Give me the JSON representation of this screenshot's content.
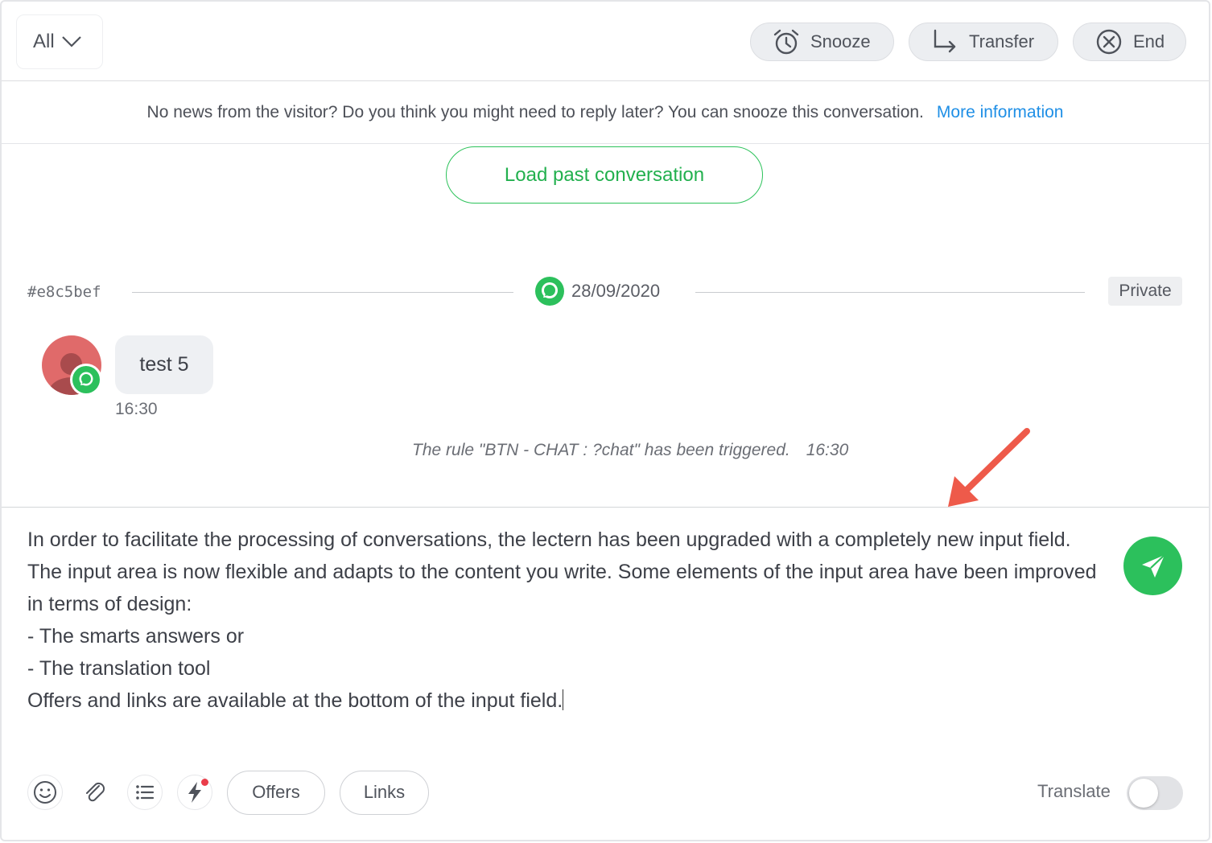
{
  "header": {
    "filter_label": "All",
    "snooze_label": "Snooze",
    "transfer_label": "Transfer",
    "end_label": "End"
  },
  "banner": {
    "text": "No news from the visitor? Do you think you might need to reply later? You can snooze this conversation.",
    "link_label": "More information",
    "link_color": "#1f8fe6"
  },
  "load_past_label": "Load past conversation",
  "conversation": {
    "id": "#e8c5bef",
    "date": "28/09/2020",
    "visibility": "Private",
    "message": {
      "text": "test 5",
      "time": "16:30",
      "channel_icon": "chat-bubble-icon"
    },
    "event": {
      "text": "The rule \"BTN - CHAT : ?chat\" has been triggered.",
      "time": "16:30"
    }
  },
  "composer": {
    "lines": [
      "In order to facilitate the processing of conversations, the lectern has been upgraded with a completely new input field.",
      "The input area is now flexible and adapts to the content you write. Some elements of the input area have been improved in terms of design:",
      "- The smarts answers or",
      "- The translation tool",
      "Offers and links are available at the bottom of the input field."
    ],
    "offers_label": "Offers",
    "links_label": "Links",
    "translate_label": "Translate",
    "translate_enabled": false,
    "tools": [
      "emoji-icon",
      "paperclip-icon",
      "list-icon",
      "lightning-icon"
    ]
  },
  "colors": {
    "accent_green": "#2cc05c",
    "annotation_arrow": "#ee5a4a"
  }
}
